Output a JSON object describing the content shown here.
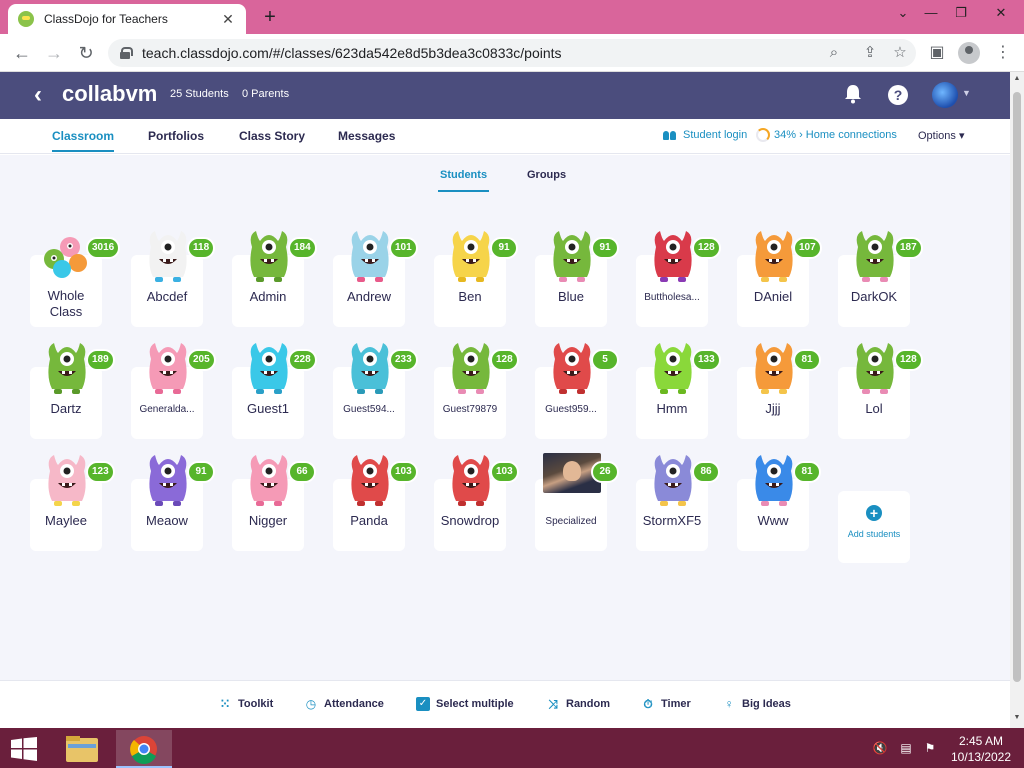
{
  "browser": {
    "tab_title": "ClassDojo for Teachers",
    "url": "teach.classdojo.com/#/classes/623da542e8d5b3dea3c0833c/points",
    "new_tab_label": "+",
    "tab_close": "✕"
  },
  "header": {
    "back": "‹",
    "class_name": "collabvm",
    "student_count": "25 Students",
    "parent_count": "0 Parents",
    "help": "?"
  },
  "nav": {
    "tabs": [
      "Classroom",
      "Portfolios",
      "Class Story",
      "Messages"
    ],
    "student_login": "Student login",
    "home_connections": "34% › Home connections",
    "options": "Options ▾"
  },
  "subtabs": [
    "Students",
    "Groups"
  ],
  "whole_class": {
    "name_line1": "Whole",
    "name_line2": "Class",
    "score": "3016"
  },
  "students": [
    {
      "name": "Abcdef",
      "score": "118",
      "color": "#f2f2f2",
      "accent": "#3ab0e2"
    },
    {
      "name": "Admin",
      "score": "184",
      "color": "#76b83c",
      "accent": "#5a9a2a"
    },
    {
      "name": "Andrew",
      "score": "101",
      "color": "#9ad3e8",
      "accent": "#e85a8a"
    },
    {
      "name": "Ben",
      "score": "91",
      "color": "#f6d44a",
      "accent": "#e6b820"
    },
    {
      "name": "Blue",
      "score": "91",
      "color": "#76b83c",
      "accent": "#e98bb4"
    },
    {
      "name": "Buttholesa...",
      "score": "128",
      "color": "#d93a4a",
      "accent": "#8a3ab4"
    },
    {
      "name": "DAniel",
      "score": "107",
      "color": "#f59a3a",
      "accent": "#f4c44a"
    },
    {
      "name": "DarkOK",
      "score": "187",
      "color": "#76b83c",
      "accent": "#e98bb4"
    },
    {
      "name": "Dartz",
      "score": "189",
      "color": "#76b83c",
      "accent": "#5a9a2a"
    },
    {
      "name": "Generalda...",
      "score": "205",
      "color": "#f59ab6",
      "accent": "#e86a96"
    },
    {
      "name": "Guest1",
      "score": "228",
      "color": "#3ac8e8",
      "accent": "#2aa0c8"
    },
    {
      "name": "Guest594...",
      "score": "233",
      "color": "#4ac0d8",
      "accent": "#2a9ab8"
    },
    {
      "name": "Guest79879",
      "score": "128",
      "color": "#76b83c",
      "accent": "#e98bb4"
    },
    {
      "name": "Guest959...",
      "score": "5",
      "color": "#e04a4a",
      "accent": "#c03030"
    },
    {
      "name": "Hmm",
      "score": "133",
      "color": "#8ad83a",
      "accent": "#6ab820"
    },
    {
      "name": "Jjjj",
      "score": "81",
      "color": "#f59a3a",
      "accent": "#f4c44a"
    },
    {
      "name": "Lol",
      "score": "128",
      "color": "#76b83c",
      "accent": "#e98bb4"
    },
    {
      "name": "Maylee",
      "score": "123",
      "color": "#f6b8c8",
      "accent": "#f4d44a"
    },
    {
      "name": "Meaow",
      "score": "91",
      "color": "#8a6ad8",
      "accent": "#6a4ab8"
    },
    {
      "name": "Nigger",
      "score": "66",
      "color": "#f59ab6",
      "accent": "#e86a96"
    },
    {
      "name": "Panda",
      "score": "103",
      "color": "#e04a4a",
      "accent": "#c03030"
    },
    {
      "name": "Snowdrop",
      "score": "103",
      "color": "#e04a4a",
      "accent": "#c03030"
    },
    {
      "name": "Specialized",
      "score": "26",
      "photo": true
    },
    {
      "name": "StormXF5",
      "score": "86",
      "color": "#8a8ad8",
      "accent": "#f4c44a"
    },
    {
      "name": "Www",
      "score": "81",
      "color": "#3a8ae8",
      "accent": "#e98bb4"
    }
  ],
  "add_students": "Add students",
  "toolbar": {
    "toolkit": "Toolkit",
    "attendance": "Attendance",
    "select_multiple": "Select multiple",
    "random": "Random",
    "timer": "Timer",
    "big_ideas": "Big Ideas"
  },
  "taskbar": {
    "time": "2:45 AM",
    "date": "10/13/2022"
  },
  "colors": {
    "header_bg": "#4b4d7d",
    "accent_blue": "#1a8fc1",
    "score_green": "#57b52b",
    "titlebar": "#d9659b",
    "taskbar": "#6a1f3c"
  }
}
